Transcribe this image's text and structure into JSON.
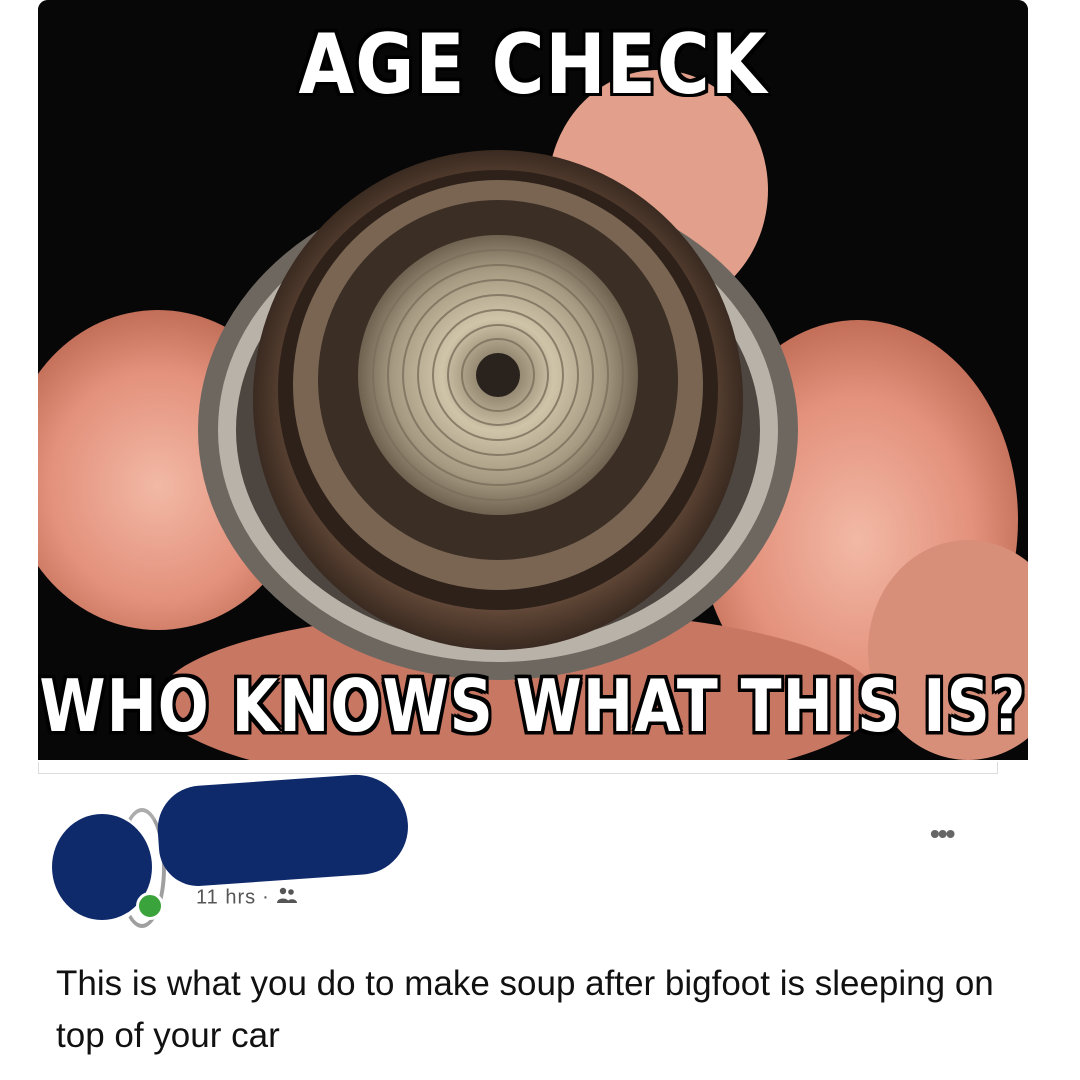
{
  "meme": {
    "top_caption": "AGE CHECK",
    "bottom_caption": "WHO KNOWS WHAT THIS IS?"
  },
  "post": {
    "time": "11 hrs",
    "separator": "·",
    "audience_icon": "friends-icon",
    "more_label": "•••",
    "body_text": "This is what you do to make soup after bigfoot is sleeping on top of your car"
  },
  "colors": {
    "redaction": "#0f2a6b",
    "online": "#3ba33b"
  }
}
